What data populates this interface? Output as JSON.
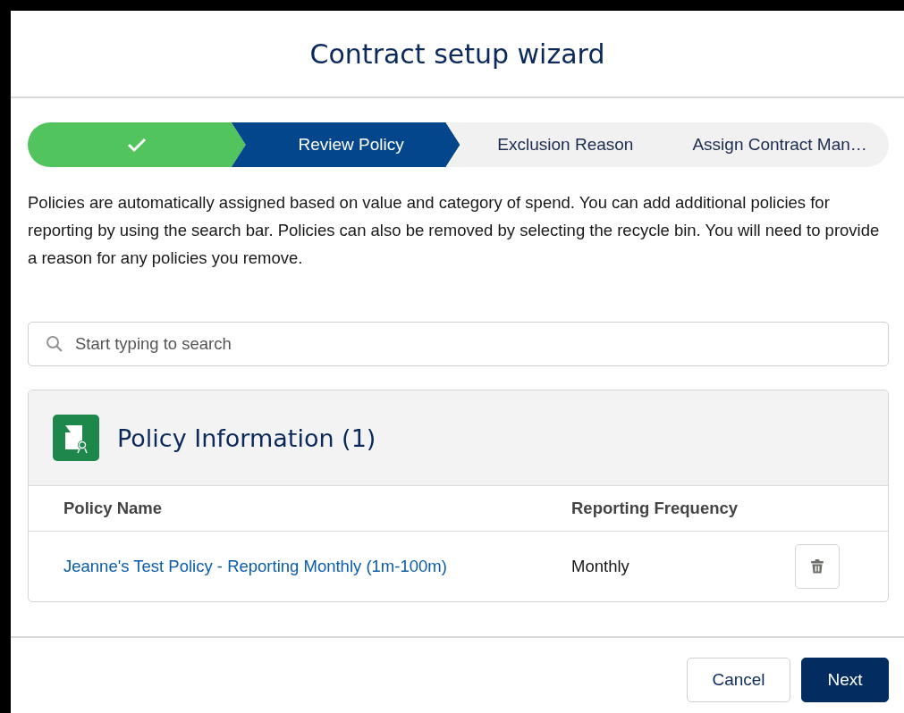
{
  "window": {
    "title": "Contract setup wizard"
  },
  "steps": [
    {
      "complete": true,
      "selected": false
    },
    {
      "label": "Review Policy",
      "complete": false,
      "selected": true
    },
    {
      "label": "Exclusion Reason",
      "complete": false,
      "selected": false
    },
    {
      "label": "Assign Contract Man…",
      "complete": false,
      "selected": false
    }
  ],
  "description": "Policies are automatically assigned based on value and category of spend. You can add additional policies for reporting by using the search bar. Policies can also be removed by selecting the recycle bin. You will need to provide a reason for any policies you remove.",
  "search": {
    "placeholder": "Start typing to search"
  },
  "card": {
    "title": "Policy Information (1)",
    "columns": [
      "Policy Name",
      "Reporting Frequency"
    ],
    "rows": [
      {
        "policy_name": "Jeanne's Test Policy - Reporting Monthly (1m-100m)",
        "reporting_frequency": "Monthly"
      }
    ]
  },
  "buttons": [
    {
      "label": "Cancel",
      "kind": "neutral"
    },
    {
      "label": "Next",
      "kind": "brand"
    }
  ]
}
